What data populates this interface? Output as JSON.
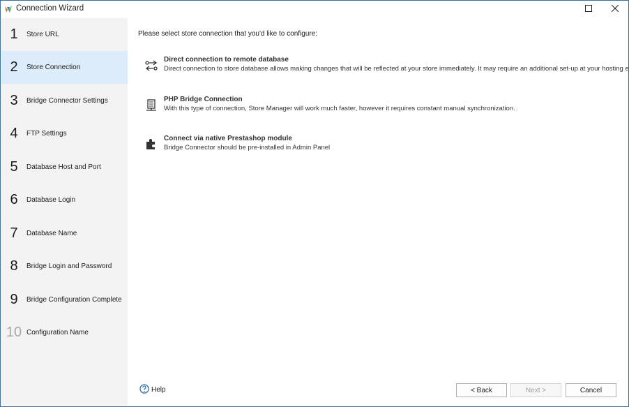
{
  "window": {
    "title": "Connection Wizard"
  },
  "steps": [
    {
      "number": "1",
      "label": "Store URL",
      "state": "normal"
    },
    {
      "number": "2",
      "label": "Store Connection",
      "state": "active"
    },
    {
      "number": "3",
      "label": "Bridge Connector Settings",
      "state": "normal"
    },
    {
      "number": "4",
      "label": "FTP Settings",
      "state": "normal"
    },
    {
      "number": "5",
      "label": "Database Host and Port",
      "state": "normal"
    },
    {
      "number": "6",
      "label": "Database Login",
      "state": "normal"
    },
    {
      "number": "7",
      "label": "Database Name",
      "state": "normal"
    },
    {
      "number": "8",
      "label": "Bridge Login and Password",
      "state": "normal"
    },
    {
      "number": "9",
      "label": "Bridge Configuration Complete",
      "state": "normal"
    },
    {
      "number": "10",
      "label": "Configuration Name",
      "state": "disabled"
    }
  ],
  "main": {
    "prompt": "Please select store connection that you'd like to configure:",
    "options": [
      {
        "icon": "direct-connection-icon",
        "title": "Direct connection to remote database",
        "description": "Direct connection to store database allows making changes that will be reflected at your store immediately. It may require an additional set-up at your hosting end."
      },
      {
        "icon": "php-bridge-icon",
        "title": "PHP Bridge Connection",
        "description": "With this type of connection, Store Manager will work much faster, however it requires constant manual synchronization."
      },
      {
        "icon": "puzzle-module-icon",
        "title": "Connect via native Prestashop module",
        "description": "Bridge Connector should be pre-installed in Admin Panel"
      }
    ]
  },
  "footer": {
    "help_label": "Help",
    "back_label": "< Back",
    "next_label": "Next >",
    "cancel_label": "Cancel"
  },
  "colors": {
    "active_step_bg": "#dcecfa",
    "sidebar_bg": "#f3f3f3",
    "window_border": "#3a6ea5",
    "help_icon": "#2b6cb0"
  }
}
